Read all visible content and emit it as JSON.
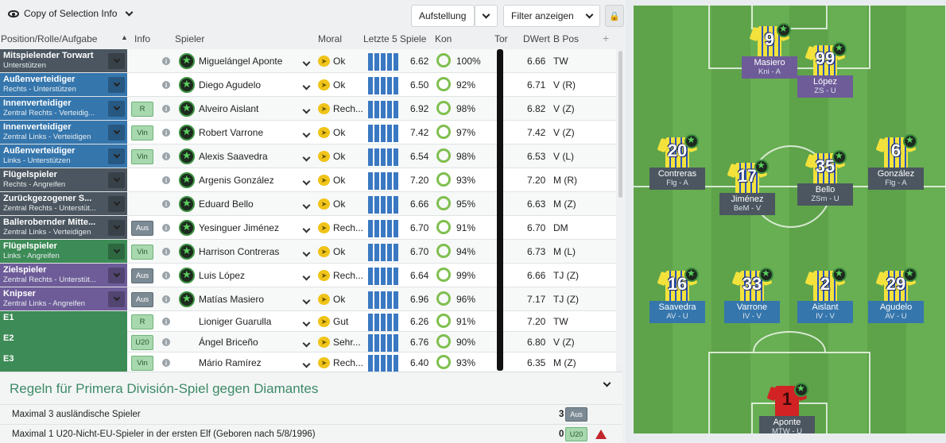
{
  "toolbar": {
    "view_label": "Copy of Selection Info",
    "aufstellung": "Aufstellung",
    "filter": "Filter anzeigen"
  },
  "columns": [
    "Position/Rolle/Aufgabe",
    "Info",
    "Spieler",
    "Moral",
    "Letzte 5 Spiele",
    "Kon",
    "Tor",
    "DWert",
    "B Pos",
    "+"
  ],
  "rows": [
    {
      "pos": "Mitspielender Torwart",
      "role": "Unterstützen",
      "color": "#4b5660",
      "tag": "",
      "player": "Miguelángel Aponte",
      "moral": "Ok",
      "rating": "6.62",
      "kon": "100%",
      "dwert": "6.66",
      "bpos": "TW",
      "form": [
        22,
        22,
        22,
        22,
        22
      ]
    },
    {
      "pos": "Außenverteidiger",
      "role": "Rechts - Unterstützen",
      "color": "#3576ad",
      "tag": "",
      "player": "Diego Agudelo",
      "moral": "Ok",
      "rating": "6.50",
      "kon": "92%",
      "dwert": "6.71",
      "bpos": "V (R)",
      "form": [
        22,
        22,
        22,
        22,
        22
      ]
    },
    {
      "pos": "Innenverteidiger",
      "role": "Zentral Rechts - Verteidig...",
      "color": "#3576ad",
      "tag": "R",
      "tagstyle": "green",
      "player": "Alveiro Aislant",
      "moral": "Rech...",
      "rating": "6.92",
      "kon": "98%",
      "dwert": "6.82",
      "bpos": "V (Z)",
      "form": [
        22,
        22,
        22,
        22,
        22
      ]
    },
    {
      "pos": "Innenverteidiger",
      "role": "Zentral Links - Verteidigen",
      "color": "#3576ad",
      "tag": "Vin",
      "tagstyle": "green",
      "player": "Robert Varrone",
      "moral": "Ok",
      "rating": "7.42",
      "kon": "97%",
      "dwert": "7.42",
      "bpos": "V (Z)",
      "form": [
        22,
        22,
        22,
        22,
        22
      ]
    },
    {
      "pos": "Außenverteidiger",
      "role": "Links - Unterstützen",
      "color": "#3576ad",
      "tag": "Vin",
      "tagstyle": "green",
      "player": "Alexis Saavedra",
      "moral": "Ok",
      "rating": "6.54",
      "kon": "98%",
      "dwert": "6.53",
      "bpos": "V (L)",
      "form": [
        22,
        22,
        22,
        22,
        22
      ]
    },
    {
      "pos": "Flügelspieler",
      "role": "Rechts - Angreifen",
      "color": "#4b5660",
      "tag": "",
      "player": "Argenis González",
      "moral": "Ok",
      "rating": "7.20",
      "kon": "93%",
      "dwert": "7.20",
      "bpos": "M (R)",
      "form": [
        22,
        22,
        22,
        22,
        22
      ]
    },
    {
      "pos": "Zurückgezogener S...",
      "role": "Zentral Rechts - Unterstüt...",
      "color": "#4b5660",
      "tag": "",
      "player": "Eduard Bello",
      "moral": "Ok",
      "rating": "6.66",
      "kon": "95%",
      "dwert": "6.63",
      "bpos": "M (Z)",
      "form": [
        22,
        22,
        22,
        22,
        22
      ]
    },
    {
      "pos": "Ballerobernder Mitte...",
      "role": "Zentral Links - Verteidigen",
      "color": "#4b5660",
      "tag": "Aus",
      "tagstyle": "grey",
      "player": "Yesinguer Jiménez",
      "moral": "Rech...",
      "rating": "6.70",
      "kon": "91%",
      "dwert": "6.70",
      "bpos": "DM",
      "form": [
        22,
        22,
        22,
        22,
        22
      ]
    },
    {
      "pos": "Flügelspieler",
      "role": "Links - Angreifen",
      "color": "#3d8b56",
      "tag": "Vin",
      "tagstyle": "green",
      "player": "Harrison Contreras",
      "moral": "Ok",
      "rating": "6.70",
      "kon": "94%",
      "dwert": "6.73",
      "bpos": "M (L)",
      "form": [
        22,
        22,
        22,
        22,
        22
      ]
    },
    {
      "pos": "Zielspieler",
      "role": "Zentral Rechts - Unterstüt...",
      "color": "#6e5c99",
      "tag": "Aus",
      "tagstyle": "grey",
      "player": "Luis López",
      "moral": "Rech...",
      "rating": "6.64",
      "kon": "99%",
      "dwert": "6.66",
      "bpos": "TJ (Z)",
      "form": [
        22,
        22,
        22,
        22,
        22
      ]
    },
    {
      "pos": "Knipser",
      "role": "Zentral Links - Angreifen",
      "color": "#6e5c99",
      "tag": "Aus",
      "tagstyle": "grey",
      "player": "Matías Masiero",
      "moral": "Ok",
      "rating": "6.96",
      "kon": "96%",
      "dwert": "7.17",
      "bpos": "TJ (Z)",
      "form": [
        22,
        22,
        22,
        22,
        22
      ]
    },
    {
      "pos": "E1",
      "role": "",
      "color": "#3d8b56",
      "tag": "R",
      "tagstyle": "green",
      "player": "Lioniger Guarulla",
      "moral": "Gut",
      "rating": "6.26",
      "kon": "91%",
      "dwert": "7.20",
      "bpos": "TW",
      "form": [
        22,
        22,
        22,
        22,
        22
      ]
    },
    {
      "pos": "E2",
      "role": "",
      "color": "#3d8b56",
      "tag": "U20",
      "tagstyle": "green",
      "player": "Ángel Briceño",
      "moral": "Sehr...",
      "rating": "6.76",
      "kon": "90%",
      "dwert": "6.80",
      "bpos": "V (Z)",
      "form": [
        22,
        22,
        22,
        22,
        22
      ]
    },
    {
      "pos": "E3",
      "role": "",
      "color": "#3d8b56",
      "tag": "Vin",
      "tagstyle": "green",
      "player": "Mário Ramírez",
      "moral": "Rech...",
      "rating": "6.40",
      "kon": "93%",
      "dwert": "6.35",
      "bpos": "M (Z)",
      "form": [
        22,
        22,
        22,
        22,
        22
      ]
    }
  ],
  "rules": {
    "title": "Regeln für Primera División-Spiel gegen Diamantes",
    "items": [
      {
        "text": "Maximal 3 ausländische Spieler",
        "count": "3",
        "tag": "Aus",
        "tagstyle": "grey",
        "warn": false
      },
      {
        "text": "Maximal 1 U20-Nicht-EU-Spieler in der ersten Elf (Geboren nach 5/8/1996)",
        "count": "0",
        "tag": "U20",
        "tagstyle": "green",
        "warn": true
      }
    ]
  },
  "pitch": [
    {
      "num": "9",
      "name": "Masiero",
      "role": "Kni - A",
      "lbl": "purple"
    },
    {
      "num": "99",
      "name": "López",
      "role": "ZS - U",
      "lbl": "purple"
    },
    {
      "num": "20",
      "name": "Contreras",
      "role": "Flg - A",
      "lbl": "grey"
    },
    {
      "num": "17",
      "name": "Jiménez",
      "role": "BeM - V",
      "lbl": "grey"
    },
    {
      "num": "35",
      "name": "Bello",
      "role": "ZSm - U",
      "lbl": "grey"
    },
    {
      "num": "6",
      "name": "González",
      "role": "Flg - A",
      "lbl": "grey"
    },
    {
      "num": "16",
      "name": "Saavedra",
      "role": "AV - U",
      "lbl": "blue"
    },
    {
      "num": "33",
      "name": "Varrone",
      "role": "IV - V",
      "lbl": "blue"
    },
    {
      "num": "2",
      "name": "Aislant",
      "role": "IV - V",
      "lbl": "blue"
    },
    {
      "num": "29",
      "name": "Agudelo",
      "role": "AV - U",
      "lbl": "blue"
    },
    {
      "num": "1",
      "name": "Aponte",
      "role": "MTW - U",
      "lbl": "grey",
      "gk": true
    }
  ]
}
